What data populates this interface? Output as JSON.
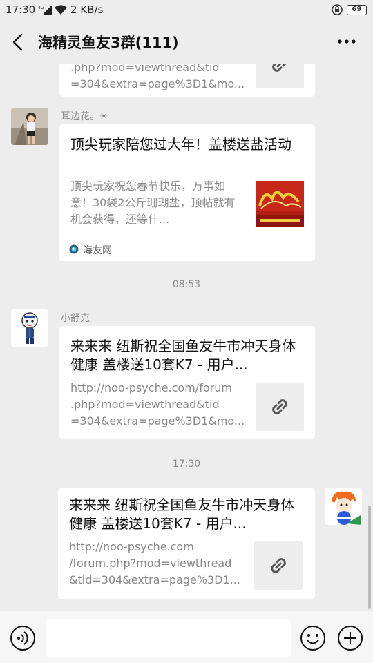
{
  "status_bar": {
    "time": "17:30",
    "signal_label": "4G",
    "speed": "2 KB/s",
    "battery": "69"
  },
  "header": {
    "title": "海精灵鱼友3群(111)",
    "back_icon": "back-arrow-icon",
    "more_icon": "more-icon"
  },
  "messages": [
    {
      "partial": true,
      "desc_line1": ".php?mod=viewthread&tid",
      "desc_line2": "=304&extra=page%3D1&mo..."
    },
    {
      "sender": "耳边花。☀",
      "title": "顶尖玩家陪您过大年！盖楼送盐活动",
      "desc": "顶尖玩家祝您春节快乐，万事如意！30袋2公斤珊瑚盐，顶帖就有机会获得，还等什...",
      "source": "海友网"
    },
    {
      "timestamp": "08:53"
    },
    {
      "sender": "小舒克",
      "title": "来来来 纽斯祝全国鱼友牛市冲天身体健康 盖楼送10套K7 - 用户...",
      "desc_line1": "http://noo-psyche.com/forum",
      "desc_line2": ".php?mod=viewthread&tid",
      "desc_line3": "=304&extra=page%3D1&mo..."
    },
    {
      "timestamp": "17:30"
    },
    {
      "self": true,
      "title": "来来来 纽斯祝全国鱼友牛市冲天身体健康 盖楼送10套K7 - 用户...",
      "desc_line1": "http://noo-psyche.com",
      "desc_line2": "/forum.php?mod=viewthread",
      "desc_line3": "&tid=304&extra=page%3D1..."
    }
  ],
  "input_bar": {
    "placeholder": "",
    "value": ""
  },
  "colors": {
    "background": "#ededed",
    "card": "#ffffff",
    "text_secondary": "#888888"
  }
}
